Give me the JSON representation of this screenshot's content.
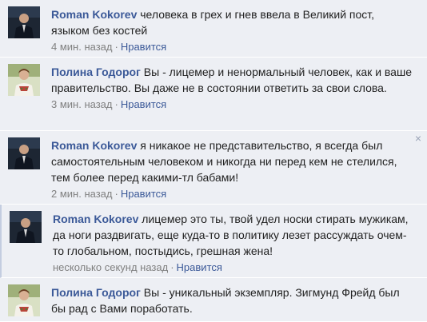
{
  "comments": [
    {
      "author": "Roman Kokorev",
      "text": "человека в грех и гнев ввела в Великий пост, языком без костей",
      "time": "4 мин. назад",
      "like_label": "Нравится"
    },
    {
      "author": "Полина Годорог",
      "text": "Вы - лицемер и ненормальный человек, как и ваше правительство. Вы даже не в состоянии ответить за свои слова.",
      "time": "3 мин. назад",
      "like_label": "Нравится"
    },
    {
      "author": "Roman Kokorev",
      "text": "я никакое не представительство, я всегда был самостоятельным человеком и никогда ни перед кем не стелился, тем более перед какими-тл бабами!",
      "time": "2 мин. назад",
      "like_label": "Нравится",
      "close_glyph": "×"
    },
    {
      "author": "Roman Kokorev",
      "text": "лицемер это ты, твой удел носки стирать мужикам, да ноги раздвигать, еще куда-то в политику лезет рассуждать очем-то глобальном, постыдись, грешная жена!",
      "time": "несколько секунд назад",
      "like_label": "Нравится"
    },
    {
      "author": "Полина Годорог",
      "text": "Вы - уникальный экземпляр. Зигмунд Фрейд был бы рад с Вами поработать."
    }
  ],
  "colors": {
    "comment_bg": "#edeff4",
    "link": "#3b5998",
    "meta": "#808080",
    "unread_border": "#c4cde0"
  },
  "icons": {
    "avatar_roman": "man-in-suit-avatar",
    "avatar_polina": "woman-embroidered-blouse-avatar",
    "close": "close-icon"
  }
}
